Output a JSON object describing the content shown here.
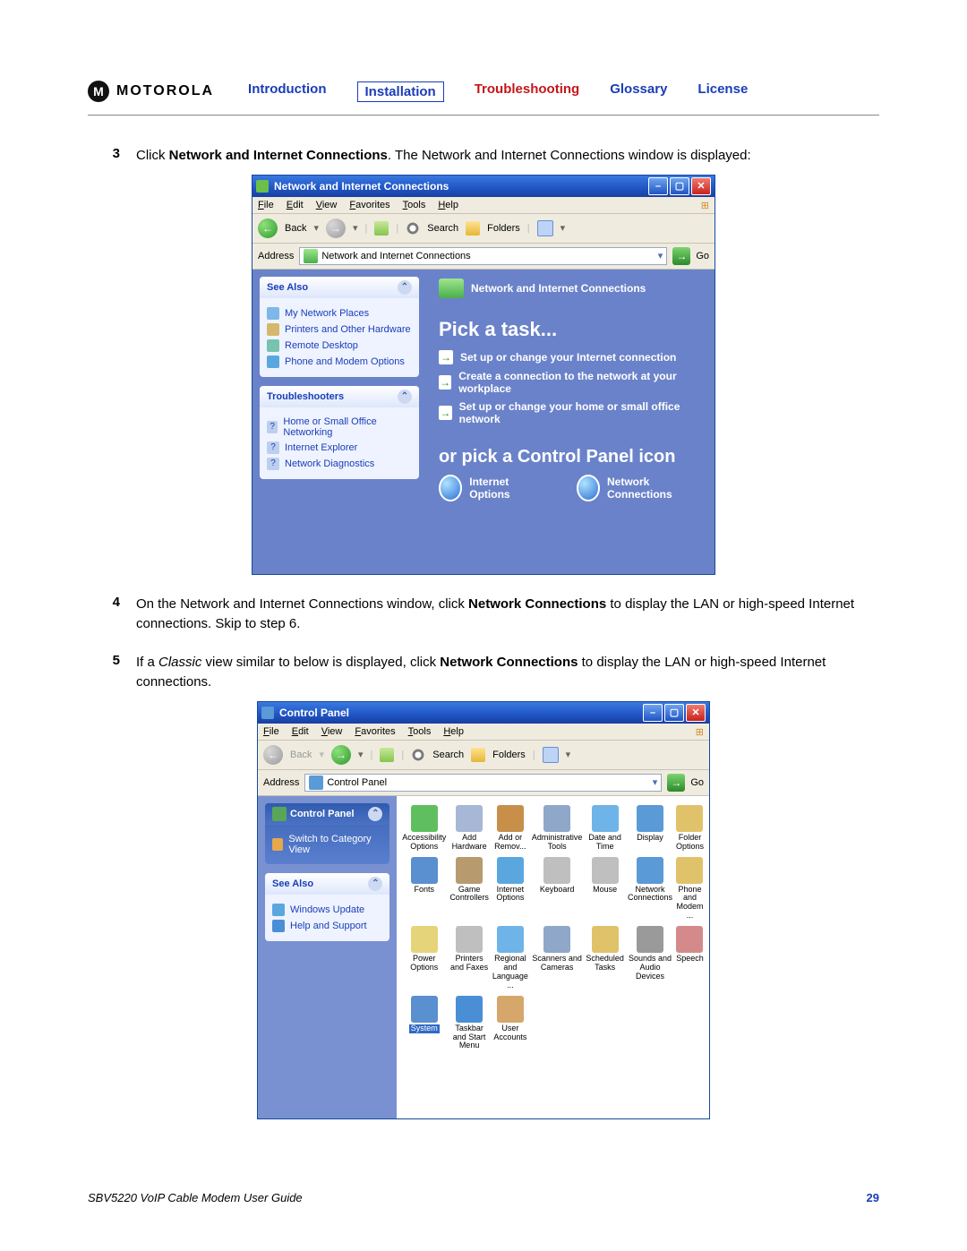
{
  "header": {
    "brand": "MOTOROLA",
    "nav": [
      "Introduction",
      "Installation",
      "Troubleshooting",
      "Glossary",
      "License"
    ],
    "nav_colors": [
      "#1a3db8",
      "#1a3db8",
      "#c4161c",
      "#1a3db8",
      "#1a3db8"
    ],
    "current_index": 1
  },
  "steps": {
    "s3_num": "3",
    "s3a": "Click ",
    "s3_bold": "Network and Internet Connections",
    "s3b": ". The Network and Internet Connections window is displayed:",
    "s4_num": "4",
    "s4a": "On the Network and Internet Connections window, click ",
    "s4_bold": "Network Connections",
    "s4b": " to display the LAN or high-speed Internet connections. Skip to step 6.",
    "s5_num": "5",
    "s5a": "If a ",
    "s5_italic": "Classic",
    "s5b": " view similar to below is displayed, click ",
    "s5_bold": "Network Connections",
    "s5c": " to display the LAN or high-speed Internet connections."
  },
  "win1": {
    "title": "Network and Internet Connections",
    "menubar": [
      "File",
      "Edit",
      "View",
      "Favorites",
      "Tools",
      "Help"
    ],
    "toolbar": {
      "back": "Back",
      "search": "Search",
      "folders": "Folders"
    },
    "address_label": "Address",
    "address_value": "Network and Internet Connections",
    "go": "Go",
    "see_also": {
      "title": "See Also",
      "items": [
        "My Network Places",
        "Printers and Other Hardware",
        "Remote Desktop",
        "Phone and Modem Options"
      ],
      "icon_bg": [
        "#7db8e8",
        "#d6b86d",
        "#76c3b0",
        "#5aa7e0"
      ]
    },
    "troubleshooters": {
      "title": "Troubleshooters",
      "items": [
        "Home or Small Office Networking",
        "Internet Explorer",
        "Network Diagnostics"
      ]
    },
    "category_title": "Network and Internet Connections",
    "pick": "Pick a task...",
    "tasks": [
      "Set up or change your Internet connection",
      "Create a connection to the network at your workplace",
      "Set up or change your home or small office network"
    ],
    "or_pick": "or pick a Control Panel icon",
    "cp_icons": [
      "Internet Options",
      "Network Connections"
    ]
  },
  "win2": {
    "title": "Control Panel",
    "menubar": [
      "File",
      "Edit",
      "View",
      "Favorites",
      "Tools",
      "Help"
    ],
    "toolbar": {
      "back": "Back",
      "search": "Search",
      "folders": "Folders"
    },
    "address_label": "Address",
    "address_value": "Control Panel",
    "go": "Go",
    "panel": {
      "title": "Control Panel",
      "switch": "Switch to Category View"
    },
    "see_also": {
      "title": "See Also",
      "items": [
        "Windows Update",
        "Help and Support"
      ],
      "icon_bg": [
        "#5aa7e0",
        "#4a8fd6"
      ]
    },
    "icons": [
      "Accessibility Options",
      "Add Hardware",
      "Add or Remov...",
      "Administrative Tools",
      "Date and Time",
      "Display",
      "Folder Options",
      "Fonts",
      "Game Controllers",
      "Internet Options",
      "Keyboard",
      "Mouse",
      "Network Connections",
      "Phone and Modem ...",
      "Power Options",
      "Printers and Faxes",
      "Regional and Language ...",
      "Scanners and Cameras",
      "Scheduled Tasks",
      "Sounds and Audio Devices",
      "Speech",
      "System",
      "Taskbar and Start Menu",
      "User Accounts"
    ],
    "icon_bg": [
      "#5fbf5f",
      "#a7b7d6",
      "#c78f4a",
      "#8fa7c8",
      "#6fb4e8",
      "#5a9ad6",
      "#e0c26a",
      "#5a8fd0",
      "#b79b6f",
      "#5aa7e0",
      "#bfbfbf",
      "#bfbfbf",
      "#5a9ad6",
      "#e0c26a",
      "#e6d47a",
      "#bfbfbf",
      "#6fb4e8",
      "#8fa7c8",
      "#e0c26a",
      "#9a9a9a",
      "#d48a8a",
      "#5a8fd0",
      "#4a8fd6",
      "#d6a76a"
    ],
    "selected_index": 21
  },
  "footer": {
    "doc": "SBV5220 VoIP Cable Modem User Guide",
    "page": "29"
  }
}
